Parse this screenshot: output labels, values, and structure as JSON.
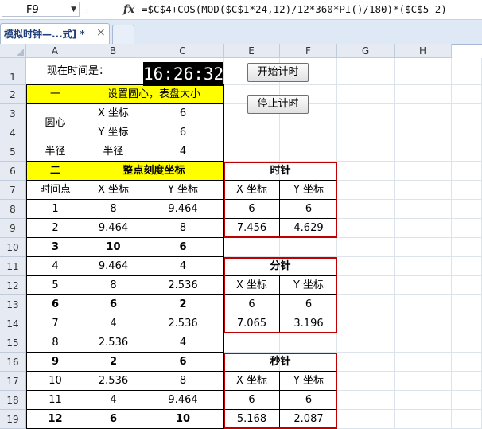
{
  "formula_bar": {
    "name_box": "F9",
    "fx_label": "fx",
    "formula": "=$C$4+COS(MOD($C$1*24,12)/12*360*PI()/180)*($C$5-2)"
  },
  "tab": {
    "title": "模拟时钟—...式] *",
    "close": "×"
  },
  "columns": [
    "A",
    "B",
    "C",
    "E",
    "F",
    "G",
    "H"
  ],
  "rows": [
    "1",
    "2",
    "3",
    "4",
    "5",
    "6",
    "7",
    "8",
    "9",
    "10",
    "11",
    "12",
    "13",
    "14",
    "15",
    "16",
    "17",
    "18",
    "19"
  ],
  "clock_label": "现在时间是：",
  "clock_value": "16:26:32",
  "buttons": {
    "start": "开始计时",
    "stop": "停止计时"
  },
  "setup": {
    "num": "一",
    "title": "设置圆心，表盘大小",
    "center_label": "圆心",
    "x_label": "X 坐标",
    "x_value": "6",
    "y_label": "Y 坐标",
    "y_value": "6",
    "radius_label_a": "半径",
    "radius_label_b": "半径",
    "radius_value": "4"
  },
  "ticks": {
    "num": "二",
    "title": "整点刻度坐标",
    "headers": [
      "时间点",
      "X 坐标",
      "Y 坐标"
    ],
    "rows": [
      [
        "1",
        "8",
        "9.464"
      ],
      [
        "2",
        "9.464",
        "8"
      ],
      [
        "3",
        "10",
        "6"
      ],
      [
        "4",
        "9.464",
        "4"
      ],
      [
        "5",
        "8",
        "2.536"
      ],
      [
        "6",
        "6",
        "2"
      ],
      [
        "7",
        "4",
        "2.536"
      ],
      [
        "8",
        "2.536",
        "4"
      ],
      [
        "9",
        "2",
        "6"
      ],
      [
        "10",
        "2.536",
        "8"
      ],
      [
        "11",
        "4",
        "9.464"
      ],
      [
        "12",
        "6",
        "10"
      ]
    ]
  },
  "hands": {
    "hour": {
      "title": "时针",
      "x_header": "X 坐标",
      "y_header": "Y 坐标",
      "r1": [
        "6",
        "6"
      ],
      "r2": [
        "7.456",
        "4.629"
      ]
    },
    "minute": {
      "title": "分针",
      "x_header": "X 坐标",
      "y_header": "Y 坐标",
      "r1": [
        "6",
        "6"
      ],
      "r2": [
        "7.065",
        "3.196"
      ]
    },
    "second": {
      "title": "秒针",
      "x_header": "X 坐标",
      "y_header": "Y 坐标",
      "r1": [
        "6",
        "6"
      ],
      "r2": [
        "5.168",
        "2.087"
      ]
    }
  }
}
